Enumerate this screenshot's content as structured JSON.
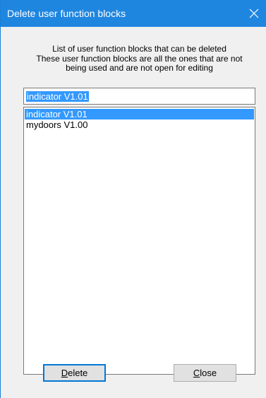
{
  "window": {
    "title": "Delete user function blocks"
  },
  "description": {
    "line1": "List of user function blocks that can be deleted",
    "line2": "These user function blocks are all the ones that are not",
    "line3": "being used and are not open for editing"
  },
  "filter": {
    "value": "indicator V1.01"
  },
  "list": {
    "items": [
      {
        "label": "indicator V1.01",
        "selected": true
      },
      {
        "label": "mydoors V1.00",
        "selected": false
      }
    ]
  },
  "buttons": {
    "delete_access_key": "D",
    "delete_rest": "elete",
    "close_access_key": "C",
    "close_rest": "lose"
  },
  "colors": {
    "titlebar": "#1f86e0",
    "selection": "#3399ff",
    "dialog_bg": "#f0f0f0",
    "default_button_border": "#0078d7"
  }
}
